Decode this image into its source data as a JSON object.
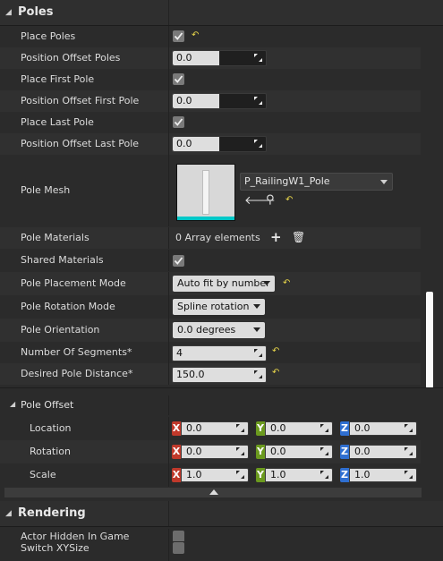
{
  "colors": {
    "x_axis": "#c0392b",
    "y_axis": "#6b9a1e",
    "z_axis": "#2f6fd1",
    "accent_cyan": "#00c8c8",
    "reset_yellow": "#e6d44a"
  },
  "poles_section": {
    "title": "Poles",
    "place_poles": {
      "label": "Place Poles",
      "checked": true
    },
    "position_offset_poles": {
      "label": "Position Offset Poles",
      "value": "0.0",
      "fill_fraction": 0.5
    },
    "place_first_pole": {
      "label": "Place First Pole",
      "checked": true
    },
    "position_offset_first_pole": {
      "label": "Position Offset First Pole",
      "value": "0.0",
      "fill_fraction": 0.5
    },
    "place_last_pole": {
      "label": "Place Last Pole",
      "checked": true
    },
    "position_offset_last_pole": {
      "label": "Position Offset Last Pole",
      "value": "0.0",
      "fill_fraction": 0.5
    },
    "pole_mesh": {
      "label": "Pole Mesh",
      "asset_name": "P_RailingW1_Pole"
    },
    "pole_materials": {
      "label": "Pole Materials",
      "value": "0 Array elements"
    },
    "shared_materials": {
      "label": "Shared Materials",
      "checked": true
    },
    "pole_placement_mode": {
      "label": "Pole Placement Mode",
      "value": "Auto fit by number"
    },
    "pole_rotation_mode": {
      "label": "Pole Rotation Mode",
      "value": "Spline rotation"
    },
    "pole_orientation": {
      "label": "Pole Orientation",
      "value": "0.0 degrees"
    },
    "number_of_segments": {
      "label": "Number Of Segments*",
      "value": "4"
    },
    "desired_pole_distance": {
      "label": "Desired Pole Distance*",
      "value": "150.0"
    }
  },
  "pole_offset": {
    "title": "Pole Offset",
    "axis_tags": [
      "X",
      "Y",
      "Z"
    ],
    "location": {
      "label": "Location",
      "x": "0.0",
      "y": "0.0",
      "z": "0.0"
    },
    "rotation": {
      "label": "Rotation",
      "x": "0.0",
      "y": "0.0",
      "z": "0.0"
    },
    "scale": {
      "label": "Scale",
      "x": "1.0",
      "y": "1.0",
      "z": "1.0"
    }
  },
  "rendering_section": {
    "title": "Rendering",
    "actor_hidden_in_game": {
      "label": "Actor Hidden In Game",
      "checked": false
    },
    "switch_xysize": {
      "label": "Switch XYSize",
      "checked": false
    }
  },
  "icons": {
    "reset": "reset-arrow-icon",
    "use_selected": "arrow-left-icon",
    "browse": "magnifier-icon",
    "add": "plus-icon",
    "delete": "trash-icon",
    "drag": "diagonal-arrows-icon"
  }
}
